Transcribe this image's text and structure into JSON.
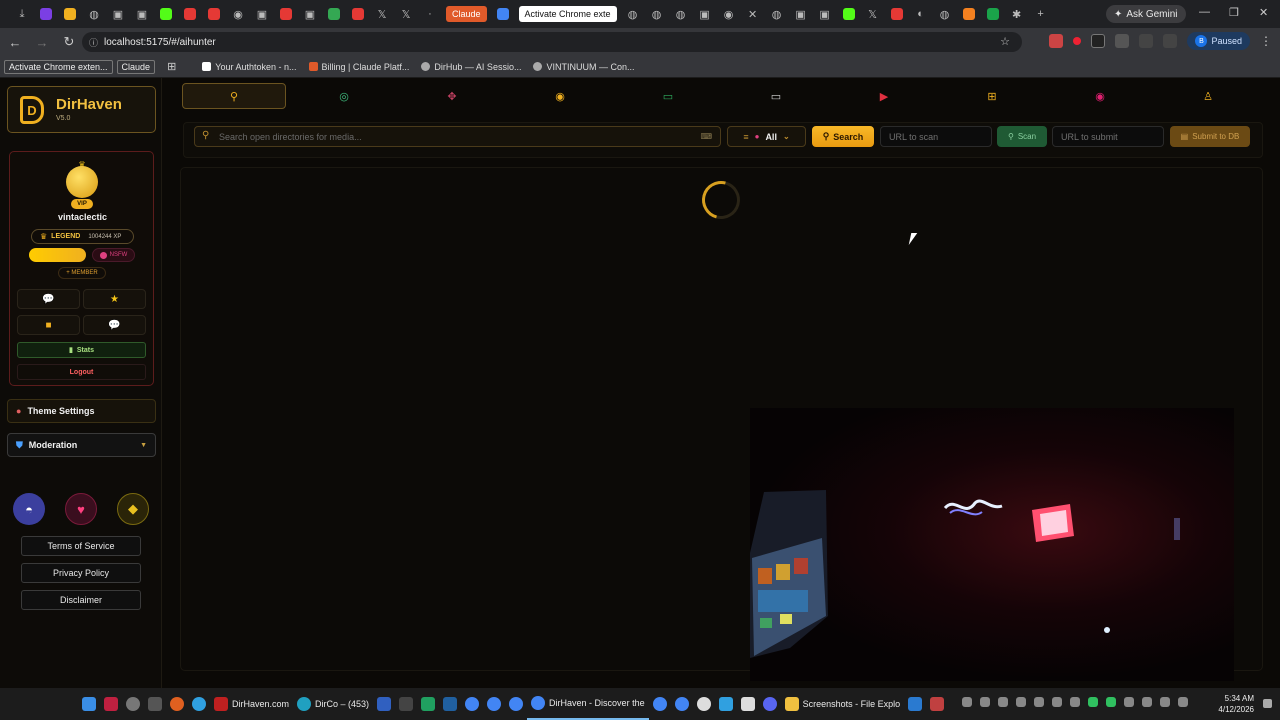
{
  "browser": {
    "tabs": {
      "claude_chip": "Claude",
      "active_tab_label": "Activate Chrome exte"
    },
    "ask_gemini": "Ask Gemini",
    "url": "localhost:5175/#/aihunter",
    "profile_status": "Paused",
    "profile_initial": "B",
    "bookmarks": [
      "Activate Chrome exten...",
      "Claude",
      "Your Authtoken - n...",
      "Billing | Claude Platf...",
      "DirHub — AI Sessio...",
      "VINTINUUM — Con..."
    ]
  },
  "app": {
    "name": "DirHaven",
    "version": "V5.0",
    "logo_letter": "D",
    "accent": "#f0b020"
  },
  "profile": {
    "badge": "VIP",
    "username": "vintaclectic",
    "rank": "LEGEND",
    "xp": "1004244 XP",
    "nsfw_label": "NSFW",
    "member_label": "+ MEMBER",
    "stats_label": "Stats",
    "logout_label": "Logout"
  },
  "menu": {
    "theme_settings": "Theme Settings",
    "moderation": "Moderation"
  },
  "footer_links": [
    "Terms of Service",
    "Privacy Policy",
    "Disclaimer"
  ],
  "search": {
    "placeholder": "Search open directories for media...",
    "filter_label": "All",
    "search_button": "Search",
    "url_scan_placeholder": "URL to scan",
    "scan_button": "Scan",
    "url_submit_placeholder": "URL to submit",
    "submit_button": "Submit to DB"
  },
  "taskbar": {
    "items": [
      "DirHaven.com",
      "DirCo – (453)",
      "DirHaven - Discover the",
      "Screenshots - File Explo"
    ],
    "time": "5:34 AM",
    "date": "4/12/2026"
  }
}
